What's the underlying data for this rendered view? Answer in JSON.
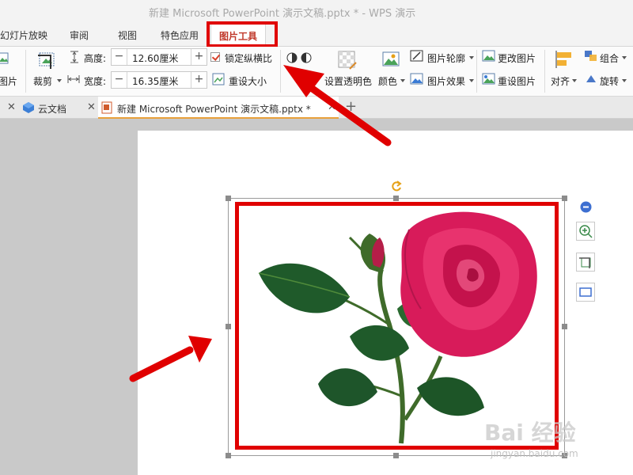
{
  "window": {
    "title": "新建 Microsoft PowerPoint 演示文稿.pptx * - WPS 演示"
  },
  "menu": {
    "tabs": [
      "幻灯片放映",
      "审阅",
      "视图",
      "特色应用",
      "图片工具"
    ],
    "active": "图片工具"
  },
  "ribbon": {
    "insert_picture_label": "图片",
    "crop_label": "裁剪",
    "height_label": "高度:",
    "height_value": "12.60厘米",
    "width_label": "宽度:",
    "width_value": "16.35厘米",
    "lock_ratio_label": "锁定纵横比",
    "lock_ratio_checked": true,
    "reset_size_label": "重设大小",
    "set_transparent_label": "设置透明色",
    "color_label": "颜色",
    "picture_outline_label": "图片轮廓",
    "picture_effect_label": "图片效果",
    "change_picture_label": "更改图片",
    "reset_picture_label": "重设图片",
    "align_label": "对齐",
    "group_label": "组合",
    "rotate_label": "旋转"
  },
  "doc_tabs": [
    {
      "label": "云文档",
      "active": false
    },
    {
      "label": "新建 Microsoft PowerPoint 演示文稿.pptx *",
      "active": true
    }
  ],
  "watermark": {
    "text": "Bai 经验",
    "sub": "jingyan.baidu.com"
  },
  "colors": {
    "annotation_red": "#e00000",
    "active_tab_text": "#c0392b",
    "rose_petal": "#d81b5a",
    "leaf_green": "#1f5a2a"
  },
  "icons": [
    "insert-picture-icon",
    "crop-icon",
    "height-icon",
    "width-icon",
    "checkbox-icon",
    "reset-size-icon",
    "transparent-color-icon",
    "color-icon",
    "picture-outline-icon",
    "picture-effect-icon",
    "change-picture-icon",
    "reset-picture-icon",
    "align-icon",
    "group-icon",
    "rotate-icon",
    "cloud-icon",
    "ppt-file-icon",
    "add-tab-icon",
    "rotate-handle-icon",
    "zoom-minus-icon",
    "zoom-in-icon",
    "crop-side-icon",
    "frame-side-icon",
    "arrow-annotation-icon"
  ]
}
